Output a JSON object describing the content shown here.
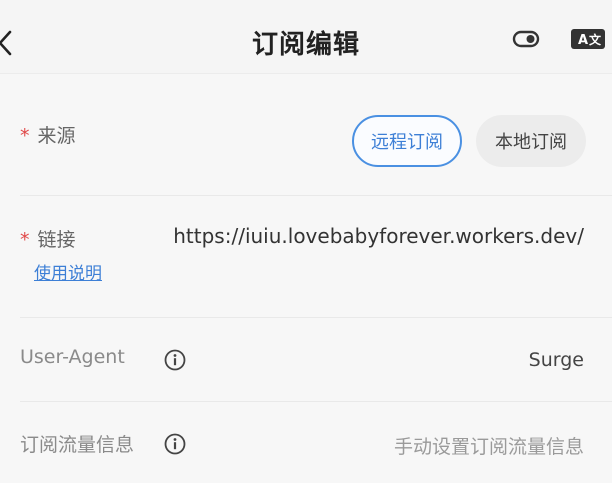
{
  "header": {
    "title": "订阅编辑",
    "back_icon": "chevron-left-icon",
    "theme_toggle_icon": "toggle-icon",
    "translate_icon": "translate-icon"
  },
  "form": {
    "source": {
      "required_mark": "*",
      "label": "来源",
      "options": [
        "远程订阅",
        "本地订阅"
      ],
      "selected": "远程订阅"
    },
    "link": {
      "required_mark": "*",
      "label": "链接",
      "value": "https://iuiu.lovebabyforever.workers.dev/",
      "help_link": "使用说明"
    },
    "user_agent": {
      "label": "User-Agent",
      "value": "Surge",
      "info_icon": "info-icon"
    },
    "traffic_info": {
      "label": "订阅流量信息",
      "placeholder": "手动设置订阅流量信息",
      "info_icon": "info-icon"
    }
  },
  "colors": {
    "accent": "#4a90e2",
    "required": "#e04848",
    "background": "#f7f7f7"
  }
}
